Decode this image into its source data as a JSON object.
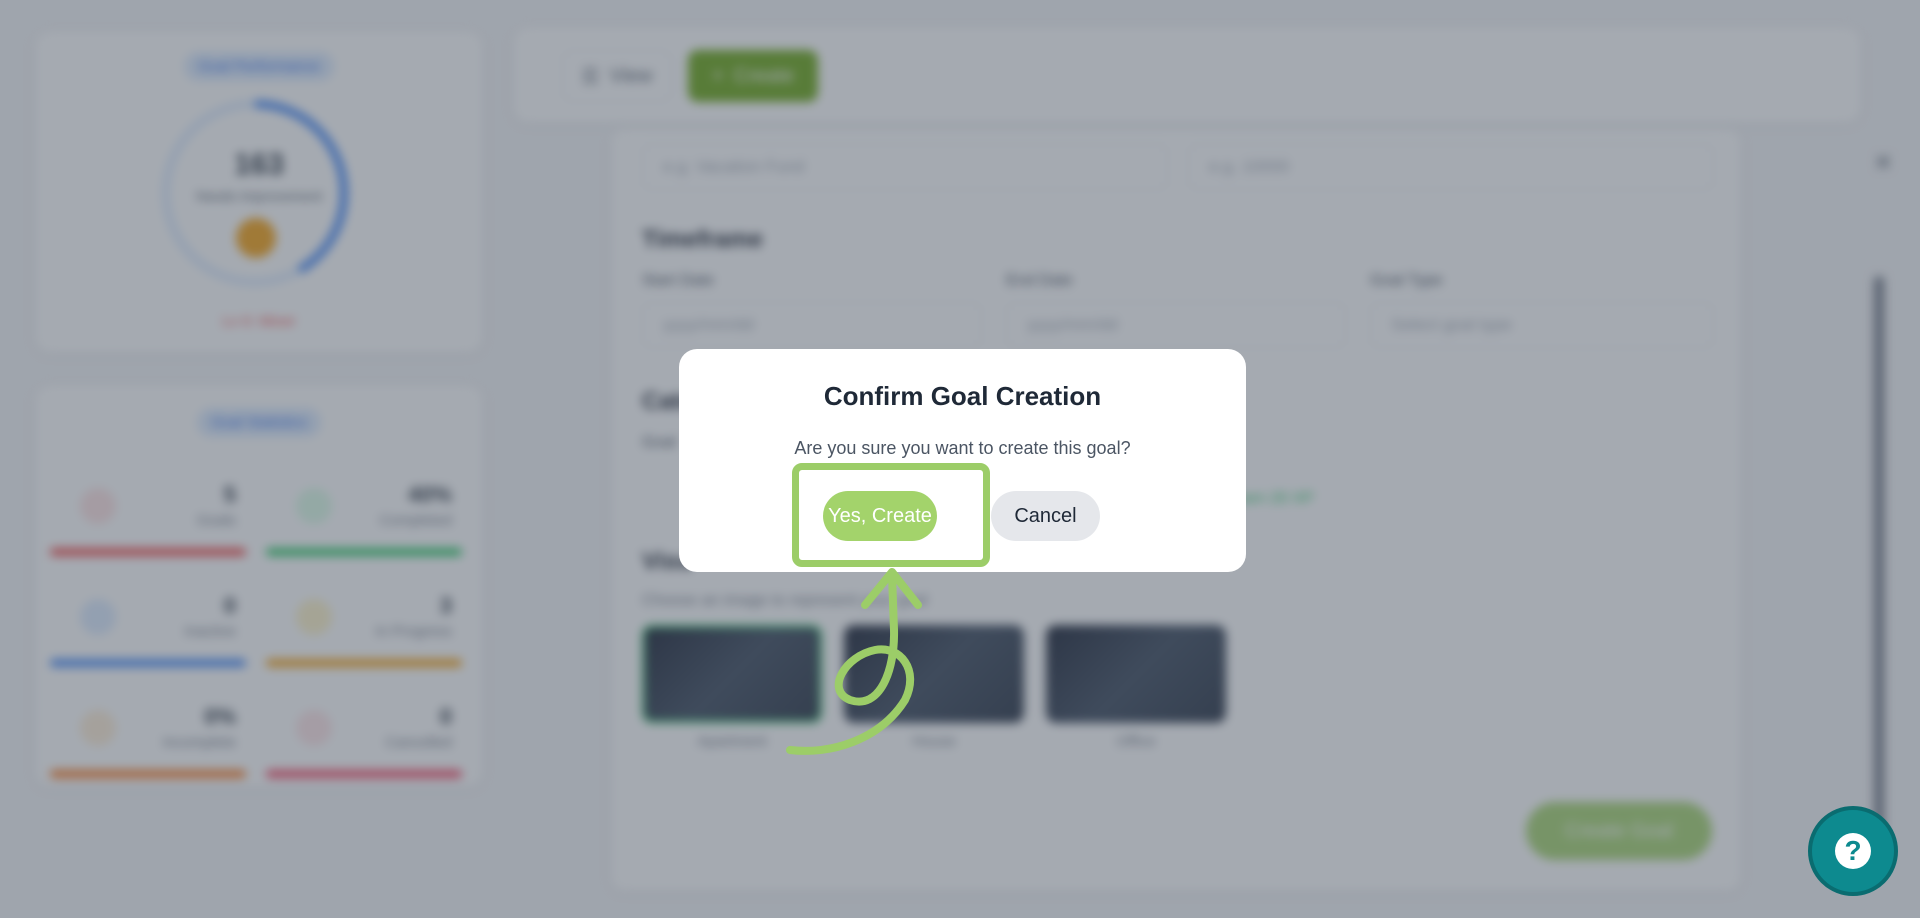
{
  "performance": {
    "title": "Goal Performance",
    "score": "163",
    "subtitle": "Needs Improvement",
    "level": "Lv 0: Mixer"
  },
  "statistics": {
    "title": "Goal Statistics",
    "items": [
      {
        "value": "5",
        "label": "Goals",
        "color": "#ef4444"
      },
      {
        "value": "40%",
        "label": "Completed",
        "color": "#22c55e"
      },
      {
        "value": "0",
        "label": "Inactive",
        "color": "#3b82f6"
      },
      {
        "value": "3",
        "label": "In Progress",
        "color": "#f59e0b"
      },
      {
        "value": "0%",
        "label": "Incomplete",
        "color": "#f97316"
      },
      {
        "value": "0",
        "label": "Cancelled",
        "color": "#f43f5e"
      }
    ]
  },
  "toolbar": {
    "view_label": "View",
    "create_label": "Create"
  },
  "form": {
    "name_placeholder": "e.g. Vacation Fund",
    "amount_placeholder": "e.g. 10000",
    "timeframe_heading": "Timeframe",
    "start_date_label": "Start Date",
    "start_date_placeholder": "yyyy/mm/dd",
    "end_date_label": "End Date",
    "end_date_placeholder": "yyyy/mm/dd",
    "goal_type_label": "Goal Type",
    "goal_type_placeholder": "Select goal type",
    "category_heading": "Cate",
    "category_label": "Goal",
    "points_text": "Earn 20 XP",
    "visual_heading": "Visu",
    "visual_hint": "Choose an image to represent your goal",
    "thumbs": [
      "Apartment",
      "House",
      "Office"
    ],
    "submit_label": "Create Goal"
  },
  "modal": {
    "title": "Confirm Goal Creation",
    "message": "Are you sure you want to create this goal?",
    "confirm_label": "Yes, Create",
    "cancel_label": "Cancel"
  },
  "colors": {
    "accent_green": "#a3d36b",
    "highlight_green": "#9ccd68",
    "help_teal": "#0d8a8f"
  },
  "icons": {
    "help": "question-circle-icon",
    "close": "close-icon"
  }
}
